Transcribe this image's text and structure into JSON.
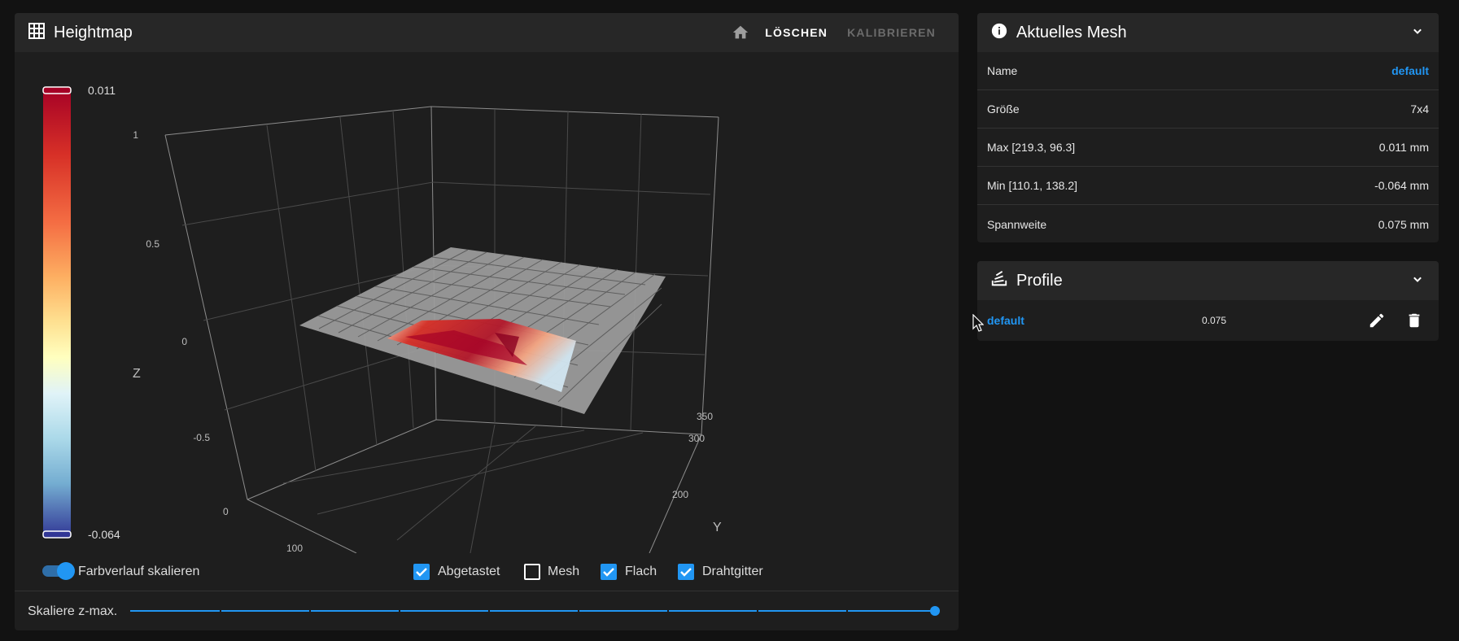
{
  "heightmap": {
    "title": "Heightmap",
    "actions": {
      "clear_label": "LÖSCHEN",
      "calibrate_label": "KALIBRIEREN"
    },
    "colorbar": {
      "max_label": "0.011",
      "min_label": "-0.064"
    },
    "axes": {
      "z_label": "Z",
      "z_ticks": [
        "1",
        "0.5",
        "0",
        "-0.5"
      ],
      "y_label": "Y",
      "y_ticks": [
        "350",
        "300",
        "200"
      ],
      "x_ticks": [
        "0",
        "100"
      ]
    },
    "controls": {
      "scale_gradient_label": "Farbverlauf skalieren",
      "scale_gradient_on": true,
      "checkboxes": [
        {
          "label": "Abgetastet",
          "checked": true
        },
        {
          "label": "Mesh",
          "checked": false
        },
        {
          "label": "Flach",
          "checked": true
        },
        {
          "label": "Drahtgitter",
          "checked": true
        }
      ]
    },
    "slider": {
      "label": "Skaliere z-max.",
      "value_fraction": 1.0
    }
  },
  "mesh": {
    "title": "Aktuelles Mesh",
    "rows": [
      {
        "label": "Name",
        "value": "default"
      },
      {
        "label": "Größe",
        "value": "7x4"
      },
      {
        "label": "Max [219.3, 96.3]",
        "value": "0.011 mm"
      },
      {
        "label": "Min [110.1, 138.2]",
        "value": "-0.064 mm"
      },
      {
        "label": "Spannweite",
        "value": "0.075 mm"
      }
    ]
  },
  "profiles": {
    "title": "Profile",
    "items": [
      {
        "name": "default",
        "value": "0.075"
      }
    ]
  },
  "colors": {
    "accent": "#2196f3",
    "card": "#1e1e1e",
    "header": "#272727",
    "background": "#121212"
  },
  "icons": {
    "heightmap": "grid-icon",
    "home": "home-icon",
    "mesh": "info-icon",
    "profiles": "stack-icon",
    "collapse": "chevron-down-icon",
    "edit": "pencil-icon",
    "delete": "trash-icon"
  }
}
